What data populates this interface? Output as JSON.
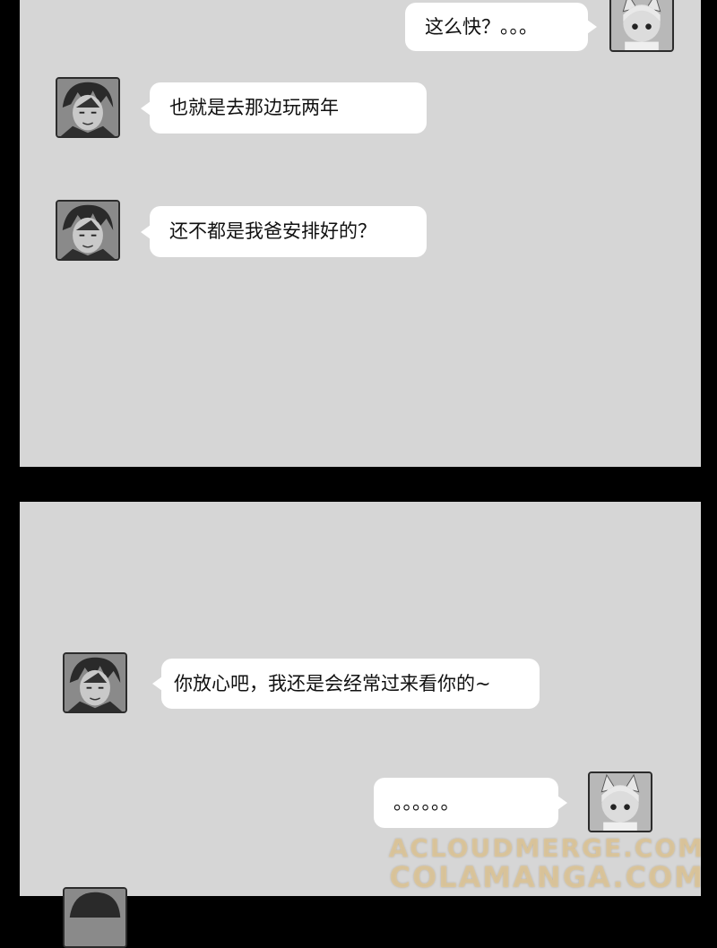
{
  "messages": [
    {
      "sender": "girl",
      "text": "这么快？。。。"
    },
    {
      "sender": "boy",
      "text": "也就是去那边玩两年"
    },
    {
      "sender": "boy",
      "text": "还不都是我爸安排好的？"
    },
    {
      "sender": "boy",
      "text": "你放心吧，我还是会经常过来看你的~"
    },
    {
      "sender": "girl",
      "text": "。。。。。。"
    }
  ],
  "avatars": {
    "boy": "boy-avatar-icon",
    "girl": "cat-ear-girl-avatar-icon"
  },
  "watermark": {
    "line1": "ACLOUDMERGE.COM",
    "line2": "COLAMANGA.COM"
  },
  "colors": {
    "panel": "#d6d6d6",
    "bubble": "#ffffff",
    "gutter": "#000000"
  }
}
